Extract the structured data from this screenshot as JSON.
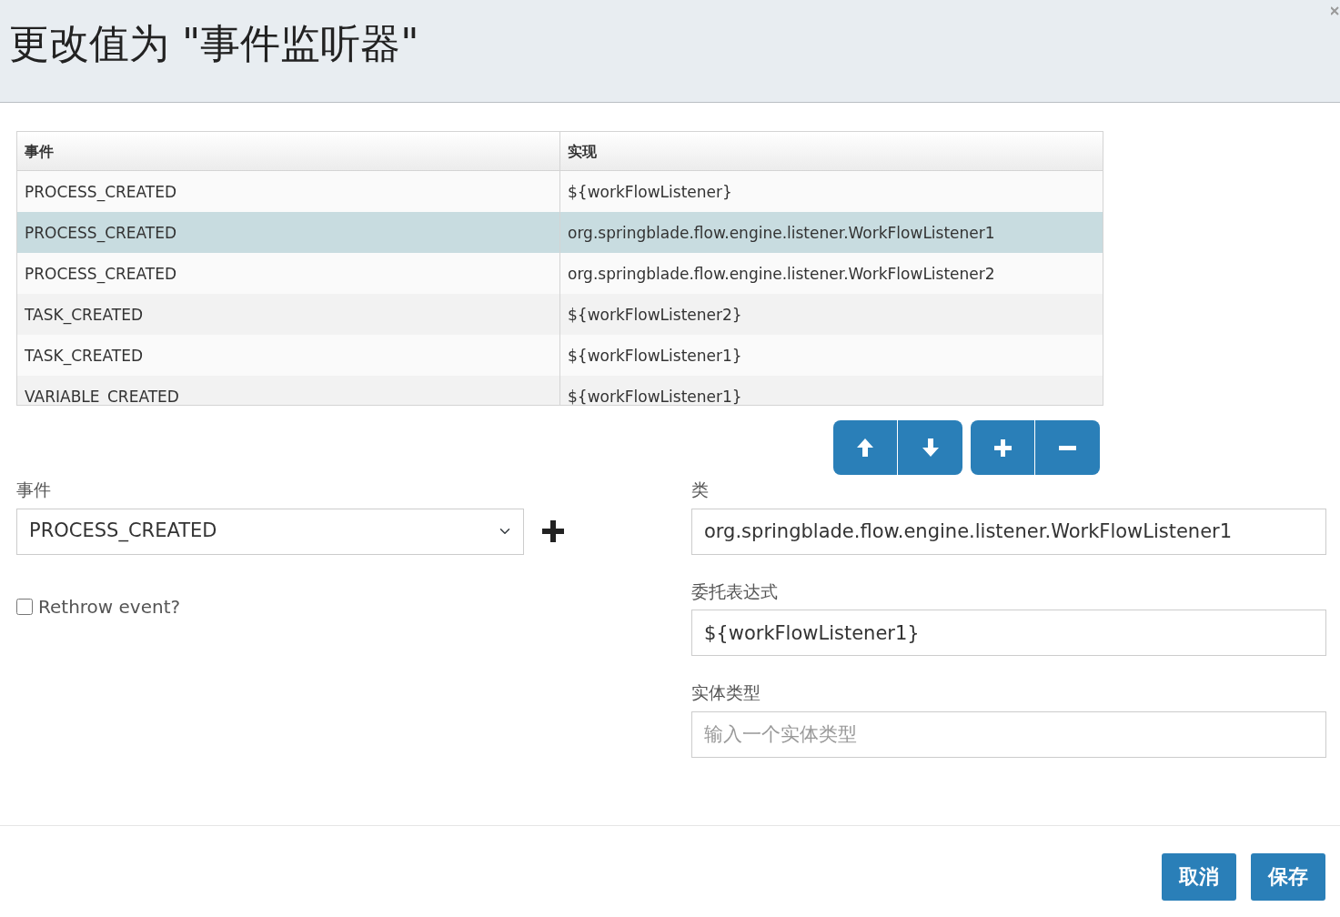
{
  "dialog": {
    "title": "更改值为 \"事件监听器\""
  },
  "table": {
    "columns": [
      "事件",
      "实现"
    ],
    "rows": [
      {
        "cells": [
          "PROCESS_CREATED",
          "${workFlowListener}"
        ],
        "selected": false
      },
      {
        "cells": [
          "PROCESS_CREATED",
          "org.springblade.flow.engine.listener.WorkFlowListener1"
        ],
        "selected": true
      },
      {
        "cells": [
          "PROCESS_CREATED",
          "org.springblade.flow.engine.listener.WorkFlowListener2"
        ],
        "selected": false
      },
      {
        "cells": [
          "TASK_CREATED",
          "${workFlowListener2}"
        ],
        "selected": false
      },
      {
        "cells": [
          "TASK_CREATED",
          "${workFlowListener1}"
        ],
        "selected": false
      },
      {
        "cells": [
          "VARIABLE_CREATED",
          "${workFlowListener1}"
        ],
        "selected": false
      }
    ]
  },
  "toolbar": [
    {
      "kind": "up"
    },
    {
      "kind": "down"
    },
    {
      "kind": "add"
    },
    {
      "kind": "remove"
    }
  ],
  "event_field": {
    "label": "事件",
    "value": "PROCESS_CREATED"
  },
  "rethrow": {
    "label": "Rethrow event?",
    "checked": false
  },
  "fields": [
    {
      "label": "类",
      "value": "org.springblade.flow.engine.listener.WorkFlowListener1"
    },
    {
      "label": "委托表达式",
      "value": "${workFlowListener1}"
    },
    {
      "label": "实体类型",
      "placeholder": "输入一个实体类型"
    }
  ],
  "buttons": [
    "取消",
    "保存"
  ]
}
